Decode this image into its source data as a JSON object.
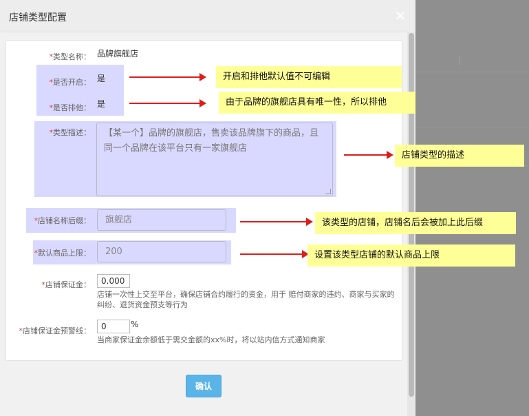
{
  "dialog": {
    "title": "店铺类型配置",
    "close_symbol": "✕"
  },
  "form": {
    "required_mark": "*",
    "type_name": {
      "label": "类型名称：",
      "value": "品牌旗舰店"
    },
    "is_open": {
      "label": "是否开启：",
      "value": "是"
    },
    "is_exclusive": {
      "label": "是否排他：",
      "value": "是"
    },
    "type_desc": {
      "label": "类型描述：",
      "value": "【某一个】品牌的旗舰店，售卖该品牌旗下的商品，且同一个品牌在该平台只有一家旗舰店"
    },
    "name_suffix": {
      "label": "店铺名称后缀：",
      "value": "旗舰店"
    },
    "default_limit": {
      "label": "默认商品上限：",
      "value": "200"
    },
    "deposit": {
      "label": "店铺保证金：",
      "value": "0.000",
      "help": "店铺一次性上交至平台，确保店铺合约履行的资金，用于 赔付商家的违约、商家与买家的纠纷、退货资金预支等行为"
    },
    "deposit_warning": {
      "label": "店铺保证金预警线：",
      "value": "0",
      "unit": "%",
      "help": "当商家保证金余额低于需交金额的xx%时，将以站内信方式通知商家"
    }
  },
  "footer": {
    "confirm_label": "确认"
  },
  "annotations": {
    "note_open_exclusive": "开启和排他默认值不可编辑",
    "note_exclusive": "由于品牌的旗舰店具有唯一性，所以排他",
    "note_desc": "店铺类型的描述",
    "note_suffix": "该类型的店铺，店铺名后会被加上此后缀",
    "note_limit": "设置该类型店铺的默认商品上限"
  },
  "colors": {
    "highlight": "#d9d8fe",
    "note_bg": "#ffff98",
    "arrow": "#e01b1b",
    "required": "#e4393c",
    "confirm_button": "#5bb4e7"
  }
}
